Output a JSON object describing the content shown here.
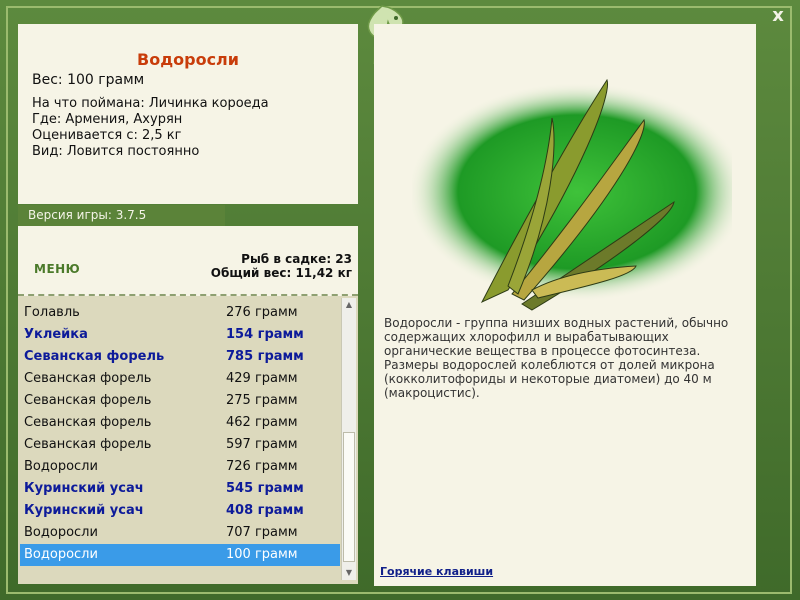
{
  "fish": {
    "title": "Водоросли",
    "weight": "Вес: 100 грамм",
    "caught_on": "На что поймана: Личинка короеда",
    "where": "Где: Армения, Ахурян",
    "valued_from": "Оценивается с: 2,5 кг",
    "kind": "Вид: Ловится постоянно"
  },
  "version": "Версия игры: 3.7.5",
  "menu_label": "МЕНЮ",
  "stats": {
    "in_net": "Рыб в садке: 23",
    "total_weight": "Общий вес: 11,42 кг"
  },
  "catch_list": [
    {
      "name": "Голавль",
      "weight": "276 грамм",
      "bold": false,
      "selected": false
    },
    {
      "name": "Уклейка",
      "weight": "154 грамм",
      "bold": true,
      "selected": false
    },
    {
      "name": "Севанская форель",
      "weight": "785 грамм",
      "bold": true,
      "selected": false
    },
    {
      "name": "Севанская форель",
      "weight": "429 грамм",
      "bold": false,
      "selected": false
    },
    {
      "name": "Севанская форель",
      "weight": "275 грамм",
      "bold": false,
      "selected": false
    },
    {
      "name": "Севанская форель",
      "weight": "462 грамм",
      "bold": false,
      "selected": false
    },
    {
      "name": "Севанская форель",
      "weight": "597 грамм",
      "bold": false,
      "selected": false
    },
    {
      "name": "Водоросли",
      "weight": "726 грамм",
      "bold": false,
      "selected": false
    },
    {
      "name": "Куринский усач",
      "weight": "545 грамм",
      "bold": true,
      "selected": false
    },
    {
      "name": "Куринский усач",
      "weight": "408 грамм",
      "bold": true,
      "selected": false
    },
    {
      "name": "Водоросли",
      "weight": "707 грамм",
      "bold": false,
      "selected": false
    },
    {
      "name": "Водоросли",
      "weight": "100 грамм",
      "bold": false,
      "selected": true
    }
  ],
  "description": "Водоросли - группа низших водных растений, обычно содержащих хлорофилл и вырабатывающих органические вещества в процессе фотосинтеза. Размеры водорослей колеблются от долей микрона (кокколитофориды и некоторые диатомеи) до 40 м (макроцистис).",
  "hotkeys_label": "Горячие клавиши",
  "close_label": "x",
  "colors": {
    "accent_green": "#5b8339",
    "title_red": "#c83c0a",
    "bold_blue": "#0d1b9a",
    "selected": "#3a9be8"
  }
}
